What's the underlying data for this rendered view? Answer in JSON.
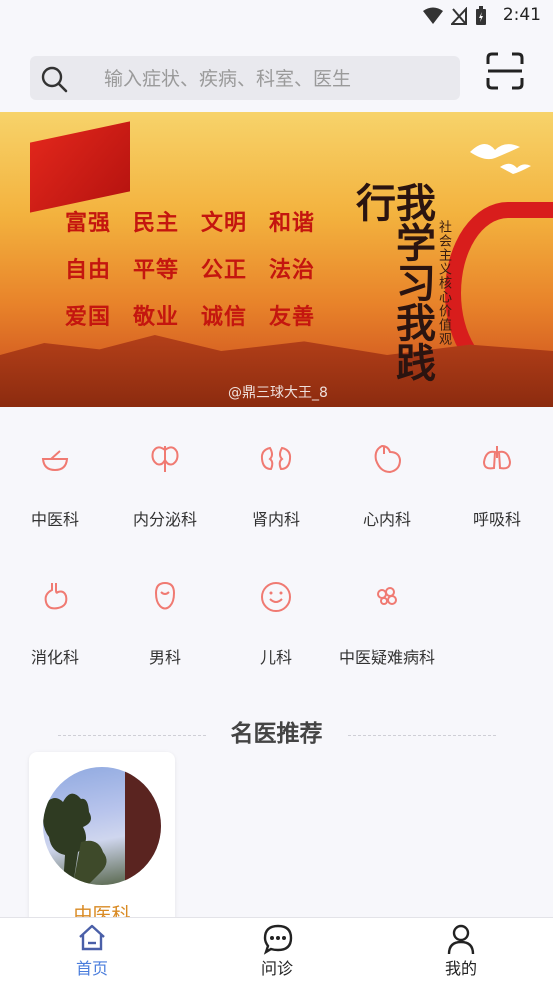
{
  "status_bar": {
    "time": "2:41"
  },
  "search": {
    "placeholder": "输入症状、疾病、科室、医生"
  },
  "banner": {
    "rows": [
      [
        "富强",
        "民主",
        "文明",
        "和谐"
      ],
      [
        "自由",
        "平等",
        "公正",
        "法治"
      ],
      [
        "爱国",
        "敬业",
        "诚信",
        "友善"
      ]
    ],
    "calligraphy": "我学习我践行",
    "vertical_text": "社会主义核心价值观",
    "watermark": "@鼎三球大王_8"
  },
  "departments": [
    {
      "label": "中医科",
      "icon": "herbal-bowl-icon"
    },
    {
      "label": "内分泌科",
      "icon": "thyroid-icon"
    },
    {
      "label": "肾内科",
      "icon": "kidney-icon"
    },
    {
      "label": "心内科",
      "icon": "heart-icon"
    },
    {
      "label": "呼吸科",
      "icon": "lungs-icon"
    },
    {
      "label": "消化科",
      "icon": "stomach-icon"
    },
    {
      "label": "男科",
      "icon": "male-organ-icon"
    },
    {
      "label": "儿科",
      "icon": "child-face-icon"
    },
    {
      "label": "中医疑难病科",
      "icon": "herb-cluster-icon"
    }
  ],
  "section": {
    "title": "名医推荐"
  },
  "doctors": [
    {
      "dept": "中医科"
    }
  ],
  "tabs": [
    {
      "label": "首页",
      "icon": "home-icon",
      "active": true
    },
    {
      "label": "问诊",
      "icon": "chat-icon",
      "active": false
    },
    {
      "label": "我的",
      "icon": "user-icon",
      "active": false
    }
  ],
  "colors": {
    "accent": "#4a7ddc",
    "dept_icon": "#f07a72",
    "doctor_dept": "#d98a23"
  }
}
